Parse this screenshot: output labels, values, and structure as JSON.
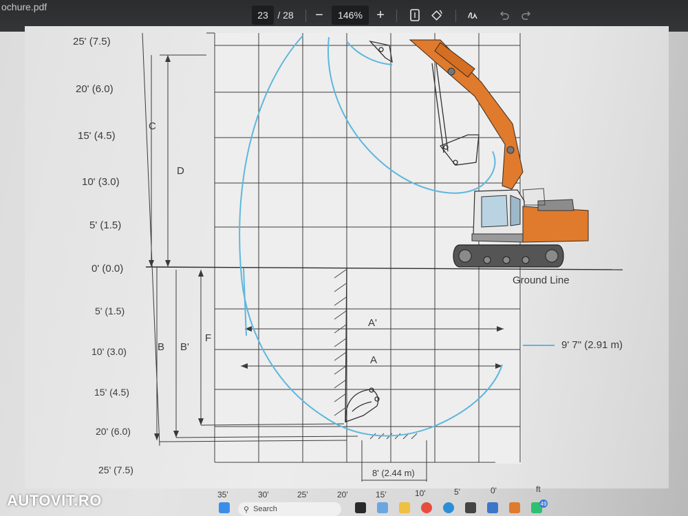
{
  "viewer": {
    "doc_title": "ochure.pdf",
    "page_current": "23",
    "page_total": "/ 28",
    "zoom_out_label": "−",
    "zoom_level": "146%",
    "zoom_in_label": "+",
    "icons": [
      "fit-page-icon",
      "rotate-icon",
      "draw-icon",
      "undo-icon",
      "redo-icon"
    ]
  },
  "diagram": {
    "height_labels": [
      "25' (7.5)",
      "20' (6.0)",
      "15' (4.5)",
      "10' (3.0)",
      "5' (1.5)",
      "0' (0.0)",
      "5' (1.5)",
      "10' (3.0)",
      "15' (4.5)",
      "20' (6.0)",
      "25' (7.5)"
    ],
    "distance_labels": [
      "35'",
      "30'",
      "25'",
      "20'",
      "15'",
      "10'",
      "5'",
      "0'"
    ],
    "unit_label": "ft",
    "dimension_letters": {
      "c": "C",
      "d": "D",
      "b": "B",
      "b_prime": "B'",
      "f": "F",
      "a": "A",
      "a_prime": "A'"
    },
    "ground_line": "Ground Line",
    "legend_label": "9' 7\" (2.91 m)",
    "bottom_dimension": "8' (2.44 m)",
    "colors": {
      "curve": "#5db7dc",
      "excavator": "#e07a2c",
      "grid": "#3c3c3c"
    }
  },
  "watermark": "AUTOVIT.RO",
  "taskbar": {
    "search_placeholder": "Search",
    "badges": [
      "49"
    ]
  }
}
